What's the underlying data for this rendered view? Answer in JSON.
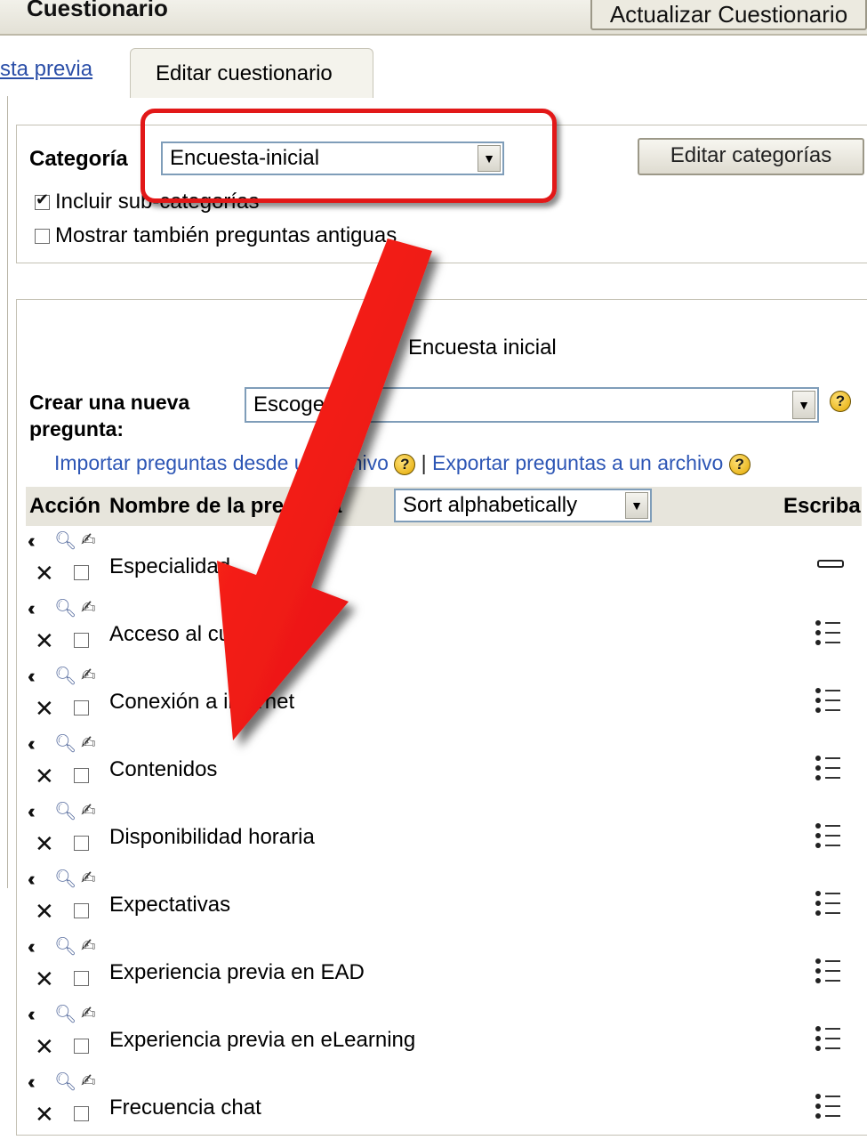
{
  "header": {
    "title": "Cuestionario",
    "update_button": "Actualizar Cuestionario"
  },
  "tabs": [
    {
      "label": "sta previa"
    },
    {
      "label": "Editar cuestionario"
    }
  ],
  "category_panel": {
    "label": "Categoría",
    "selected": "Encuesta-inicial",
    "edit_button": "Editar categorías",
    "include_subcategories": {
      "label": "Incluir sub-categorías",
      "checked": true
    },
    "show_old_questions": {
      "label": "Mostrar también preguntas antiguas",
      "checked": false
    }
  },
  "question_panel": {
    "heading": "Encuesta inicial",
    "new_question_label": "Crear una nueva pregunta:",
    "new_question_select": "Escoger...",
    "import_link": "Importar preguntas desde un archivo",
    "separator": "|",
    "export_link": "Exportar preguntas a un archivo",
    "columns": {
      "action": "Acción",
      "name": "Nombre de la pregunta",
      "sort": "Sort alphabetically",
      "type": "Escriba"
    },
    "rows": [
      {
        "name": "Especialidad",
        "type": "short-answer-icon"
      },
      {
        "name": "Acceso al curso",
        "type": "multichoice-icon"
      },
      {
        "name": "Conexión a internet",
        "type": "multichoice-icon"
      },
      {
        "name": "Contenidos",
        "type": "multichoice-icon"
      },
      {
        "name": "Disponibilidad horaria",
        "type": "multichoice-icon"
      },
      {
        "name": "Expectativas",
        "type": "multichoice-icon"
      },
      {
        "name": "Experiencia previa en EAD",
        "type": "multichoice-icon"
      },
      {
        "name": "Experiencia previa en eLearning",
        "type": "multichoice-icon"
      },
      {
        "name": "Frecuencia chat",
        "type": "multichoice-icon"
      }
    ]
  },
  "colors": {
    "link": "#2d56b5",
    "highlight": "#e21818",
    "header_bg": "#e7e5dc"
  }
}
